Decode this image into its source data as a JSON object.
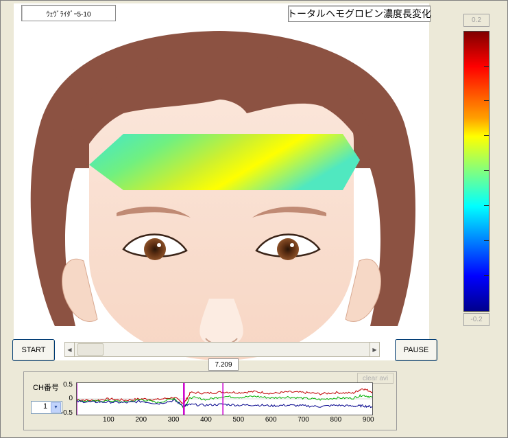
{
  "header": {
    "subject_label": "ｳｪｳﾞﾗｲﾀﾞｰ5-10",
    "title": "トータルヘモグロビン濃度長変化"
  },
  "colorbar": {
    "max_label": "0.2",
    "min_label": "-0.2"
  },
  "controls": {
    "start_label": "START",
    "pause_label": "PAUSE",
    "time_value": "7.209",
    "scroll_left_icon": "left-arrow-icon",
    "scroll_right_icon": "right-arrow-icon"
  },
  "channel": {
    "label": "CH番号",
    "selected": "1",
    "dropdown_icon": "chevron-down-icon"
  },
  "clear_button": "clear avi",
  "chart_data": {
    "type": "line",
    "x_ticks": [
      "100",
      "200",
      "300",
      "400",
      "500",
      "600",
      "700",
      "800",
      "900"
    ],
    "y_ticks": [
      "0.5",
      "0",
      "-0.5"
    ],
    "xlim": [
      0,
      910
    ],
    "ylim": [
      -0.5,
      0.5
    ],
    "markers": [
      0,
      330,
      450
    ],
    "series": [
      {
        "color": "#c00000",
        "x": [
          0,
          50,
          100,
          150,
          200,
          250,
          300,
          330,
          350,
          400,
          450,
          500,
          550,
          600,
          650,
          700,
          750,
          800,
          850,
          880,
          910
        ],
        "values": [
          -0.02,
          -0.05,
          0.0,
          -0.04,
          0.0,
          -0.02,
          0.05,
          -0.15,
          0.2,
          0.18,
          0.22,
          0.2,
          0.23,
          0.17,
          0.22,
          0.2,
          0.16,
          0.2,
          0.18,
          0.33,
          0.22
        ]
      },
      {
        "color": "#00b000",
        "x": [
          0,
          50,
          100,
          150,
          200,
          250,
          300,
          330,
          350,
          400,
          450,
          500,
          550,
          600,
          650,
          700,
          750,
          800,
          850,
          880,
          910
        ],
        "values": [
          -0.05,
          -0.08,
          -0.06,
          -0.1,
          -0.02,
          -0.12,
          0.02,
          -0.28,
          0.05,
          -0.02,
          0.08,
          0.05,
          0.08,
          0.03,
          0.06,
          0.02,
          -0.02,
          0.03,
          0.02,
          0.12,
          0.05
        ]
      },
      {
        "color": "#00008b",
        "x": [
          0,
          50,
          100,
          150,
          200,
          250,
          300,
          330,
          350,
          400,
          450,
          500,
          550,
          600,
          650,
          700,
          750,
          800,
          850,
          880,
          910
        ],
        "values": [
          -0.08,
          -0.1,
          -0.1,
          -0.12,
          -0.08,
          -0.15,
          -0.05,
          -0.22,
          -0.18,
          -0.2,
          -0.17,
          -0.2,
          -0.19,
          -0.22,
          -0.2,
          -0.22,
          -0.24,
          -0.2,
          -0.23,
          -0.22,
          -0.25
        ]
      }
    ]
  }
}
